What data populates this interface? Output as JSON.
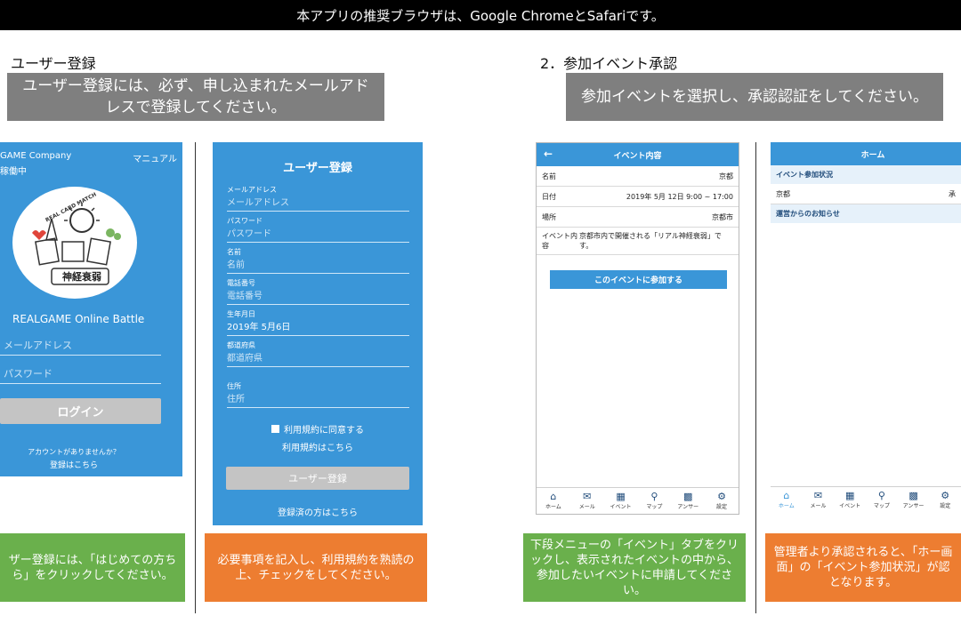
{
  "top_notice": "本アプリの推奨ブラウザは、Google ChromeとSafariです。",
  "section1": {
    "title": "ユーザー登録",
    "banner": "ユーザー登録には、必ず、申し込まれたメールアドレスで登録してください。"
  },
  "section2": {
    "title": "2．参加イベント承認",
    "banner": "参加イベントを選択し、承認認証をしてください。"
  },
  "login_screen": {
    "company": "GAME Company",
    "status": "稼働中",
    "manual_link": "マニュアル",
    "logo_top_text": "REAL CARD MATCH",
    "logo_bottom_text": "神経衰弱",
    "app_name": "REALGAME Online Battle",
    "email_placeholder": "メールアドレス",
    "password_placeholder": "パスワード",
    "login_button": "ログイン",
    "no_account_text": "アカウントがありませんか？",
    "register_link": "登録はこちら"
  },
  "register_screen": {
    "title": "ユーザー登録",
    "fields": [
      {
        "label": "メールアドレス",
        "value": "メールアドレス"
      },
      {
        "label": "パスワード",
        "value": "パスワード"
      },
      {
        "label": "名前",
        "value": "名前"
      },
      {
        "label": "電話番号",
        "value": "電話番号"
      },
      {
        "label": "生年月日",
        "value": "2019年 5月6日"
      },
      {
        "label": "都道府県",
        "value": "都道府県"
      },
      {
        "label": "住所",
        "value": "住所"
      }
    ],
    "agree_label": "利用規約に同意する",
    "terms_link": "利用規約はこちら",
    "submit_button": "ユーザー登録",
    "login_link": "登録済の方はこちら"
  },
  "event_screen": {
    "back_icon": "arrow-left-icon",
    "title": "イベント内容",
    "rows": [
      {
        "label": "名前",
        "value": "京都"
      },
      {
        "label": "日付",
        "value": "2019年 5月 12日 9:00 ~ 17:00"
      },
      {
        "label": "場所",
        "value": "京都市"
      }
    ],
    "desc_label": "イベント内容",
    "desc_value": "京都市内で開催される「リアル神経衰弱」です。",
    "join_button": "このイベントに参加する"
  },
  "home_screen": {
    "title": "ホーム",
    "status_header": "イベント参加状況",
    "status_row_name": "京都",
    "status_row_value": "承",
    "news_header": "運営からのお知らせ"
  },
  "tabs": [
    {
      "label": "ホーム",
      "icon": "home-icon",
      "glyph": "⌂"
    },
    {
      "label": "メール",
      "icon": "mail-icon",
      "glyph": "✉"
    },
    {
      "label": "イベント",
      "icon": "calendar-icon",
      "glyph": "▦"
    },
    {
      "label": "マップ",
      "icon": "map-pin-icon",
      "glyph": "⚲"
    },
    {
      "label": "アンサー",
      "icon": "grid-icon",
      "glyph": "▩"
    },
    {
      "label": "設定",
      "icon": "gear-icon",
      "glyph": "⚙"
    }
  ],
  "captions": {
    "c1": "ザー登録には、「はじめての方ちら」をクリックしてください。",
    "c2": "必要事項を記入し、利用規約を熟読の上、チェックをしてください。",
    "c3": "下段メニューの「イベント」タブをクリックし、表示されたイベントの中から、参加したいイベントに申請してください。",
    "c4": "管理者より承認されると、「ホー画面」の「イベント参加状況」が認となります。"
  },
  "colors": {
    "app_blue": "#3a96d8",
    "banner_gray": "#7f7f7f",
    "caption_green": "#6ab04c",
    "caption_orange": "#ed7d31"
  }
}
